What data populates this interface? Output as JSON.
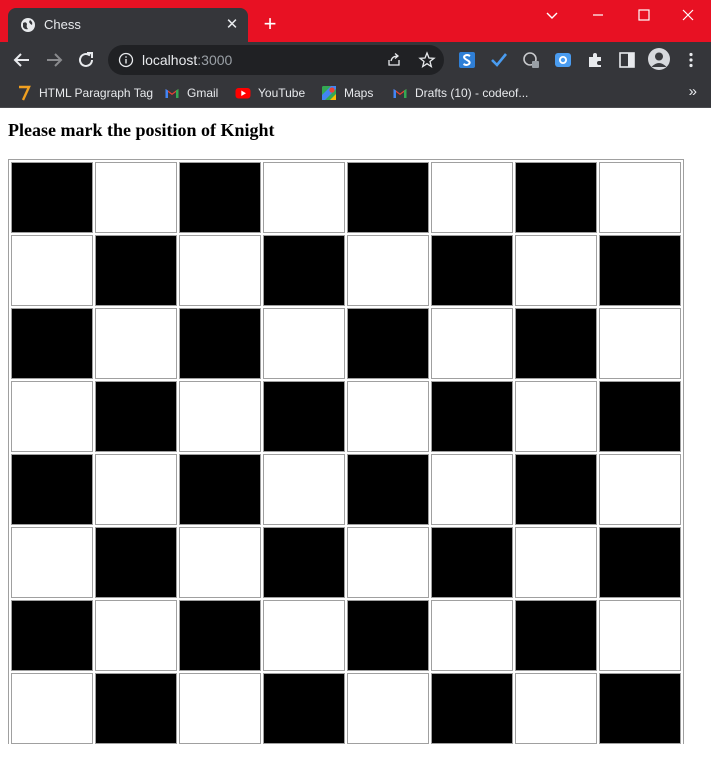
{
  "browser": {
    "tab": {
      "title": "Chess",
      "close_glyph": "✕"
    },
    "new_tab_glyph": "+",
    "accent": "#e81123",
    "address": {
      "host": "localhost",
      "port": ":3000"
    },
    "bookmarks": [
      {
        "label": "HTML Paragraph Tag",
        "icon": "seven-icon"
      },
      {
        "label": "Gmail",
        "icon": "gmail-icon"
      },
      {
        "label": "YouTube",
        "icon": "youtube-icon"
      },
      {
        "label": "Maps",
        "icon": "maps-icon"
      },
      {
        "label": "Drafts (10) - codeof...",
        "icon": "gmail-icon"
      }
    ],
    "bookmarks_more": "»"
  },
  "page": {
    "heading": "Please mark the position of Knight",
    "board": {
      "rows": 8,
      "cols": 8,
      "top_left_square": "dark",
      "dark_color": "#000000",
      "light_color": "#ffffff"
    }
  }
}
